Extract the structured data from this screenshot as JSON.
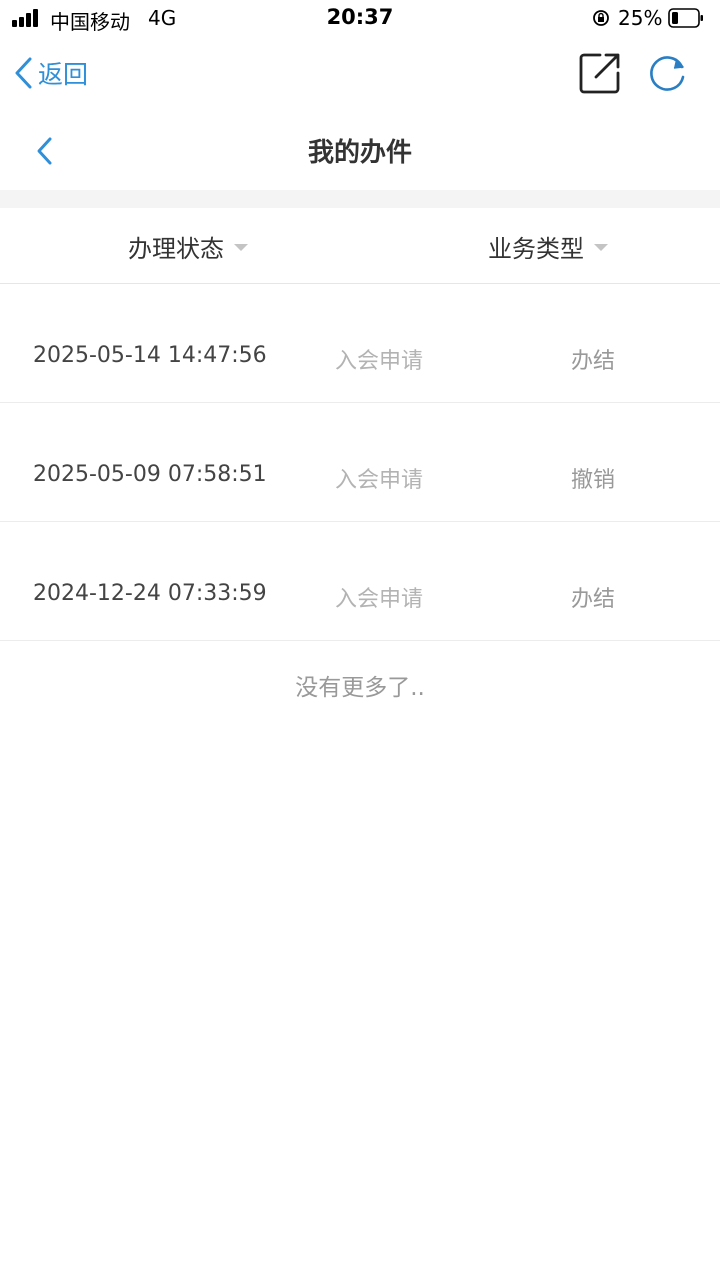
{
  "status_bar": {
    "carrier": "中国移动",
    "network": "4G",
    "time": "20:37",
    "battery": "25%",
    "battery_level": 0.25
  },
  "browser": {
    "back_label": "返回",
    "share_icon": "share-icon",
    "refresh_icon": "refresh-icon",
    "accent_color": "#2f8fd8"
  },
  "page": {
    "title": "我的办件"
  },
  "filters": [
    {
      "label": "办理状态"
    },
    {
      "label": "业务类型"
    }
  ],
  "records": [
    {
      "datetime": "2025-05-14 14:47:56",
      "business": "入会申请",
      "status": "办结"
    },
    {
      "datetime": "2025-05-09 07:58:51",
      "business": "入会申请",
      "status": "撤销"
    },
    {
      "datetime": "2024-12-24 07:33:59",
      "business": "入会申请",
      "status": "办结"
    }
  ],
  "footer_text": "没有更多了.."
}
